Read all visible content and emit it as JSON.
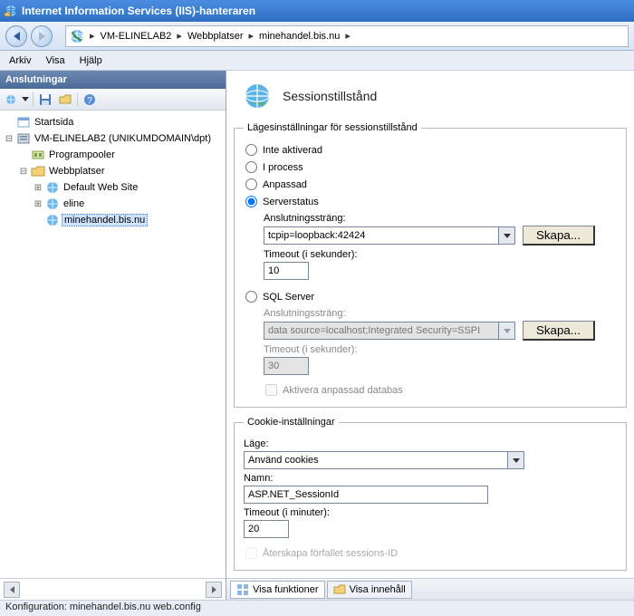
{
  "window": {
    "title": "Internet Information Services (IIS)-hanteraren"
  },
  "breadcrumb": {
    "parts": [
      "VM-ELINELAB2",
      "Webbplatser",
      "minehandel.bis.nu"
    ]
  },
  "menu": {
    "arkiv": "Arkiv",
    "visa": "Visa",
    "hjalp": "Hjälp"
  },
  "sidebar": {
    "title": "Anslutningar",
    "tree": {
      "start": "Startsida",
      "server": "VM-ELINELAB2 (UNIKUMDOMAIN\\dpt)",
      "apppools": "Programpooler",
      "sites": "Webbplatser",
      "site_default": "Default Web Site",
      "site_eline": "eline",
      "site_minehandel": "minehandel.bis.nu"
    }
  },
  "page": {
    "title": "Sessionstillstånd",
    "mode_group": "Lägesinställningar för sessionstillstånd",
    "radio_not_active": "Inte aktiverad",
    "radio_inprocess": "I process",
    "radio_custom": "Anpassad",
    "radio_stateserver": "Serverstatus",
    "conn_label": "Anslutningssträng:",
    "stateserver_conn": "tcpip=loopback:42424",
    "stateserver_timeout_label": "Timeout (i sekunder):",
    "stateserver_timeout": "10",
    "create_btn": "Skapa...",
    "radio_sql": "SQL Server",
    "sql_conn": "data source=localhost;Integrated Security=SSPI",
    "sql_timeout_label": "Timeout (i sekunder):",
    "sql_timeout": "30",
    "custom_db_chk": "Aktivera anpassad databas",
    "cookie_group": "Cookie-inställningar",
    "cookie_mode_label": "Läge:",
    "cookie_mode_value": "Använd cookies",
    "cookie_name_label": "Namn:",
    "cookie_name_value": "ASP.NET_SessionId",
    "cookie_timeout_label": "Timeout (i minuter):",
    "cookie_timeout_value": "20"
  },
  "tabs": {
    "features": "Visa funktioner",
    "content": "Visa innehåll"
  },
  "status": "Konfiguration: minehandel.bis.nu web.config"
}
